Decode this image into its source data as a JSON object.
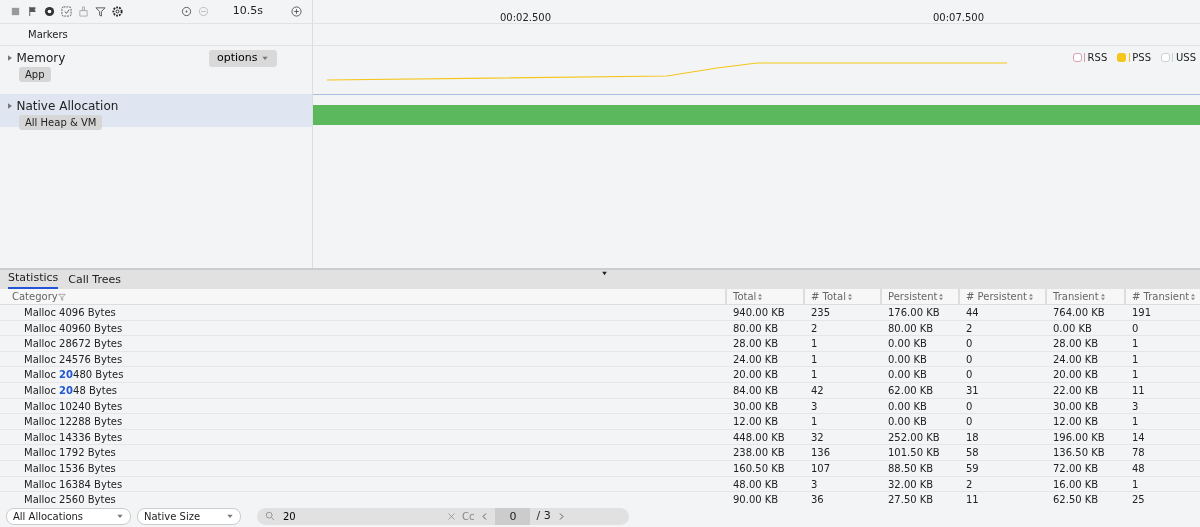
{
  "toolbar": {
    "duration": "10.5s"
  },
  "timeline": {
    "ticks": [
      "00:02.500",
      "00:07.500"
    ]
  },
  "markers_label": "Markers",
  "tracks": [
    {
      "kind": "memory",
      "title": "Memory",
      "tag": "App",
      "expanded": false,
      "selected": false,
      "options": "options",
      "legend": [
        {
          "label": "RSS",
          "checked": false,
          "color": "#d8a0b0"
        },
        {
          "label": "PSS",
          "checked": true,
          "color": "#f5c518"
        },
        {
          "label": "USS",
          "checked": false,
          "color": "#c8d0d8"
        }
      ]
    },
    {
      "kind": "native",
      "title": "Native Allocation",
      "tag": "All Heap & VM",
      "expanded": false,
      "selected": true
    }
  ],
  "tabs": [
    {
      "label": "Statistics",
      "selected": true
    },
    {
      "label": "Call Trees",
      "selected": false
    }
  ],
  "table": {
    "columns": [
      "Category",
      "Total",
      "# Total",
      "Persistent",
      "# Persistent",
      "Transient",
      "# Transient"
    ],
    "rows": [
      [
        "Malloc 4096 Bytes",
        "940.00 KB",
        "235",
        "176.00 KB",
        "44",
        "764.00 KB",
        "191"
      ],
      [
        "Malloc 40960 Bytes",
        "80.00 KB",
        "2",
        "80.00 KB",
        "2",
        "0.00 KB",
        "0"
      ],
      [
        "Malloc 28672 Bytes",
        "28.00 KB",
        "1",
        "0.00 KB",
        "0",
        "28.00 KB",
        "1"
      ],
      [
        "Malloc 24576 Bytes",
        "24.00 KB",
        "1",
        "0.00 KB",
        "0",
        "24.00 KB",
        "1"
      ],
      [
        "Malloc **20**480 Bytes",
        "20.00 KB",
        "1",
        "0.00 KB",
        "0",
        "20.00 KB",
        "1"
      ],
      [
        "Malloc **20**48 Bytes",
        "84.00 KB",
        "42",
        "62.00 KB",
        "31",
        "22.00 KB",
        "11"
      ],
      [
        "Malloc 10240 Bytes",
        "30.00 KB",
        "3",
        "0.00 KB",
        "0",
        "30.00 KB",
        "3"
      ],
      [
        "Malloc 12288 Bytes",
        "12.00 KB",
        "1",
        "0.00 KB",
        "0",
        "12.00 KB",
        "1"
      ],
      [
        "Malloc 14336 Bytes",
        "448.00 KB",
        "32",
        "252.00 KB",
        "18",
        "196.00 KB",
        "14"
      ],
      [
        "Malloc 1792 Bytes",
        "238.00 KB",
        "136",
        "101.50 KB",
        "58",
        "136.50 KB",
        "78"
      ],
      [
        "Malloc 1536 Bytes",
        "160.50 KB",
        "107",
        "88.50 KB",
        "59",
        "72.00 KB",
        "48"
      ],
      [
        "Malloc 16384 Bytes",
        "48.00 KB",
        "3",
        "32.00 KB",
        "2",
        "16.00 KB",
        "1"
      ],
      [
        "Malloc 2560 Bytes",
        "90.00 KB",
        "36",
        "27.50 KB",
        "11",
        "62.50 KB",
        "25"
      ]
    ]
  },
  "footer": {
    "allocation_filter": "All Allocations",
    "size_filter": "Native Size",
    "search": "20",
    "case_label": "Cc",
    "match_index": "0",
    "match_total": "/ 3"
  }
}
